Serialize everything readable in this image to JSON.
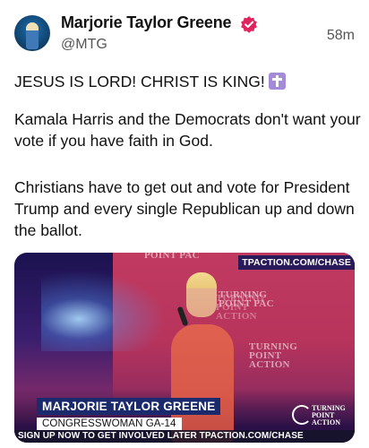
{
  "author": {
    "name": "Marjorie Taylor Greene",
    "handle": "@MTG",
    "verified_color": "#e0245e"
  },
  "post": {
    "time": "58m",
    "paragraphs": [
      "JESUS IS LORD! CHRIST IS KING!",
      "Kamala Harris and the Democrats don't want your vote if you have faith in God.",
      "Christians have to get out and vote for President Trump and every single Republican up and down the ballot."
    ],
    "emoji_icon": "latin-cross-icon"
  },
  "media": {
    "source_tag": "TPACTION.COM/CHASE",
    "lower_third_name": "MARJORIE TAYLOR GREENE",
    "lower_third_title": "CONGRESSWOMAN GA-14",
    "bug_line1": "TURNING",
    "bug_line2": "POINT ACTION",
    "ticker": "SIGN UP NOW TO GET INVOLVED LATER TPACTION.COM/CHASE",
    "backdrop_texts": [
      "TURNING POINT PAC",
      "TURNING POINT ACTION",
      "POINT PAC",
      "TURNING POINT ACTION"
    ]
  }
}
